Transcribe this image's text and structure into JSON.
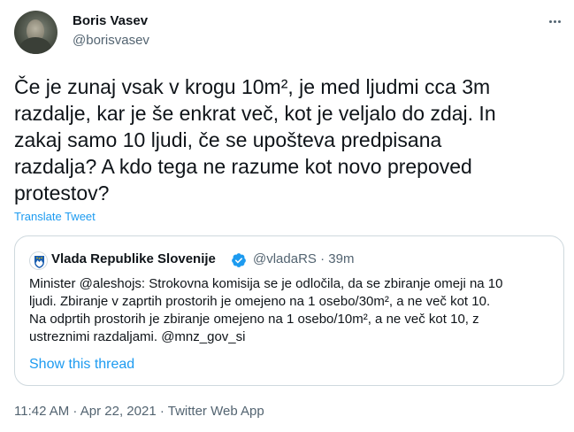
{
  "author": {
    "name": "Boris Vasev",
    "handle": "@borisvasev"
  },
  "more_icon": "more-horizontal-icon",
  "tweet": {
    "lines": [
      "Če je zunaj vsak v krogu 10m², je med ljudmi cca 3m",
      "razdalje, kar je še enkrat več, kot je veljalo do zdaj. In",
      "zakaj samo 10 ljudi, če se upošteva predpisana",
      "razdalja? A kdo tega ne razume kot novo prepoved",
      "protestov?"
    ],
    "translate_label": "Translate Tweet"
  },
  "quote": {
    "name": "Vlada Republike Slovenije",
    "verified_icon": "verified-badge-icon",
    "handle": "@vladaRS",
    "separator": "·",
    "time": "39m",
    "lines": [
      "Minister @aleshojs: Strokovna komisija se je odločila, da se zbiranje omeji na 10",
      "ljudi. Zbiranje v zaprtih prostorih je omejeno na 1 osebo/30m², a ne več kot 10.",
      "Na odprtih prostorih je zbiranje omejeno na 1 osebo/10m², a ne več kot 10, z",
      "ustreznimi razdaljami. @mnz_gov_si"
    ],
    "show_thread_label": "Show this thread"
  },
  "footer": {
    "time": "11:42 AM",
    "separator1": " · ",
    "date": "Apr 22, 2021",
    "separator2": " · ",
    "source": "Twitter Web App"
  },
  "colors": {
    "link": "#1d9bf0",
    "secondary": "#536471",
    "text": "#0f1419",
    "border": "#cfd9de"
  }
}
